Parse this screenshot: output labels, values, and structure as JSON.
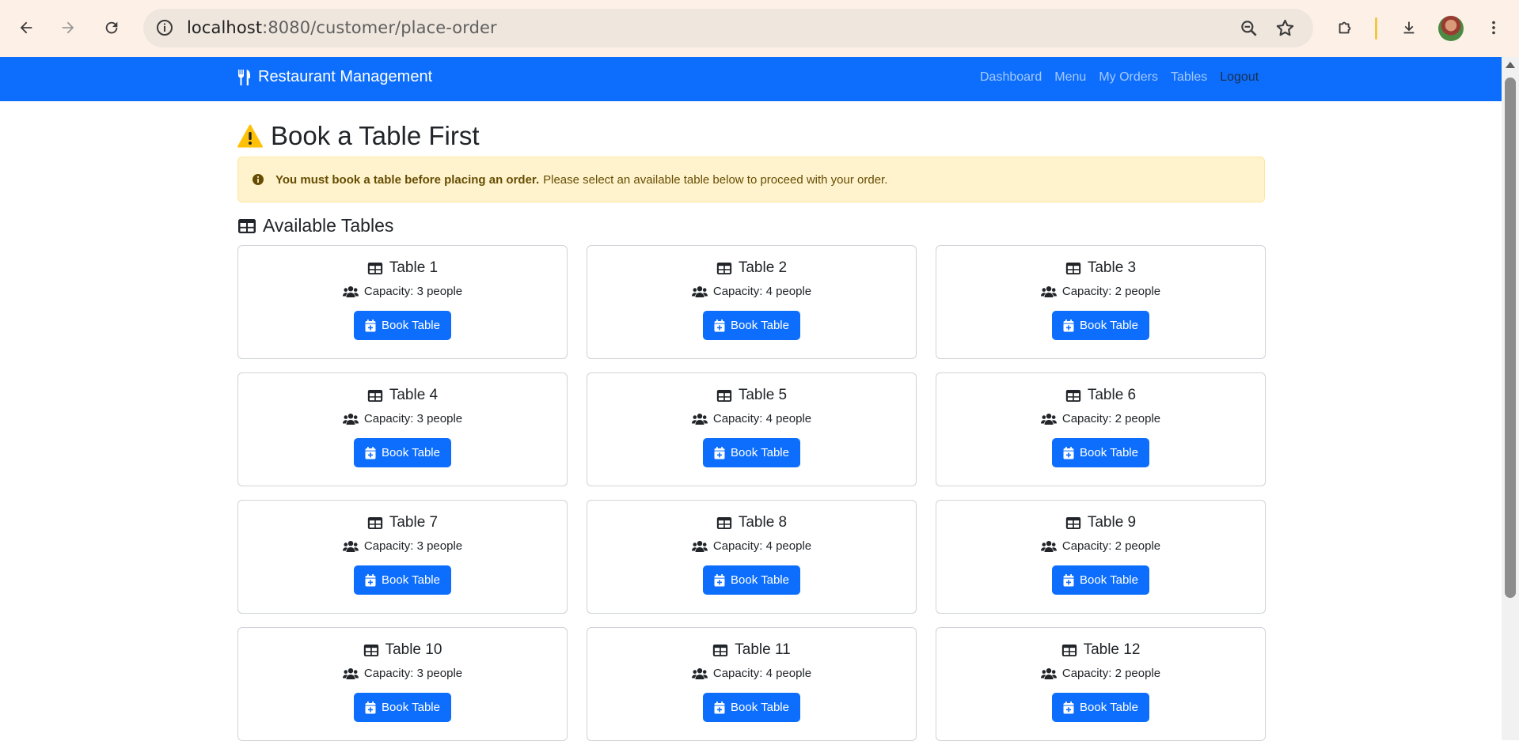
{
  "browser": {
    "url_host": "localhost",
    "url_path": ":8080/customer/place-order"
  },
  "navbar": {
    "brand": "Restaurant Management",
    "links": [
      "Dashboard",
      "Menu",
      "My Orders",
      "Tables"
    ],
    "logout": "Logout"
  },
  "page": {
    "title": "Book a Table First",
    "alert_bold": "You must book a table before placing an order.",
    "alert_text": "Please select an available table below to proceed with your order.",
    "section_title": "Available Tables"
  },
  "tables": [
    {
      "name": "Table 1",
      "capacity": "Capacity: 3 people",
      "button": "Book Table"
    },
    {
      "name": "Table 2",
      "capacity": "Capacity: 4 people",
      "button": "Book Table"
    },
    {
      "name": "Table 3",
      "capacity": "Capacity: 2 people",
      "button": "Book Table"
    },
    {
      "name": "Table 4",
      "capacity": "Capacity: 3 people",
      "button": "Book Table"
    },
    {
      "name": "Table 5",
      "capacity": "Capacity: 4 people",
      "button": "Book Table"
    },
    {
      "name": "Table 6",
      "capacity": "Capacity: 2 people",
      "button": "Book Table"
    },
    {
      "name": "Table 7",
      "capacity": "Capacity: 3 people",
      "button": "Book Table"
    },
    {
      "name": "Table 8",
      "capacity": "Capacity: 4 people",
      "button": "Book Table"
    },
    {
      "name": "Table 9",
      "capacity": "Capacity: 2 people",
      "button": "Book Table"
    },
    {
      "name": "Table 10",
      "capacity": "Capacity: 3 people",
      "button": "Book Table"
    },
    {
      "name": "Table 11",
      "capacity": "Capacity: 4 people",
      "button": "Book Table"
    },
    {
      "name": "Table 12",
      "capacity": "Capacity: 2 people",
      "button": "Book Table"
    }
  ],
  "colors": {
    "primary": "#0d6efd",
    "warning_bg": "#fff3cd",
    "warning_text": "#664d03",
    "warning_icon": "#ffc107",
    "chrome_bg": "#fdf1e7"
  }
}
